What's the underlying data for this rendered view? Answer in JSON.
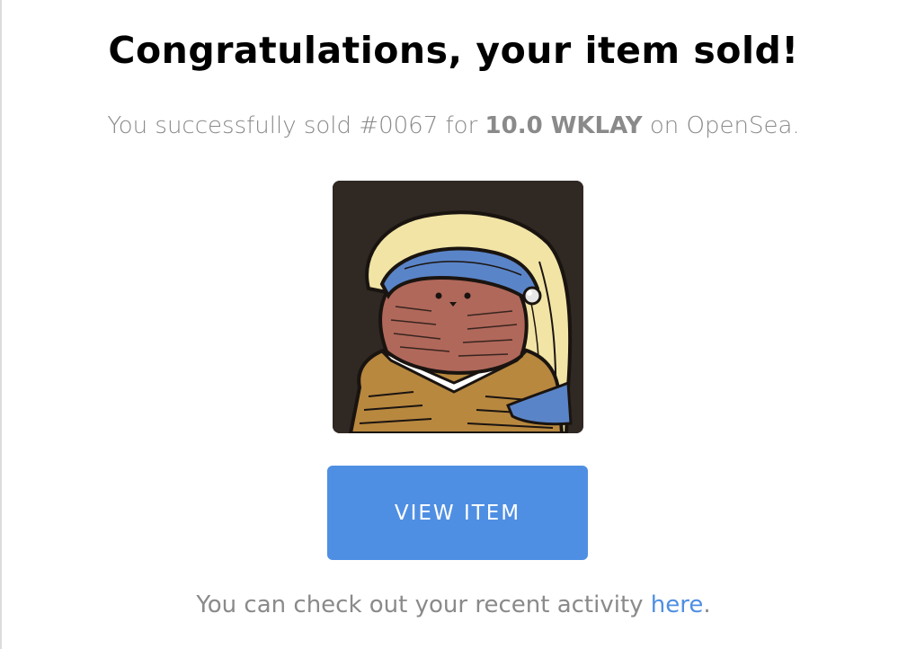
{
  "heading": "Congratulations, your item sold!",
  "message": {
    "prefix": "You successfully sold ",
    "item_id": "#0067",
    "for_text": " for ",
    "price": "10.0 WKLAY",
    "suffix": " on OpenSea."
  },
  "nft_image": {
    "icon": "bear-nft-artwork-icon"
  },
  "button": {
    "label": "VIEW ITEM"
  },
  "footer": {
    "text": "You can check out your recent activity ",
    "link_label": "here",
    "end": "."
  },
  "colors": {
    "accent": "#4f8fe3",
    "muted_text": "#8a8a8a",
    "heading": "#000000",
    "art_bg": "#2f2823"
  }
}
